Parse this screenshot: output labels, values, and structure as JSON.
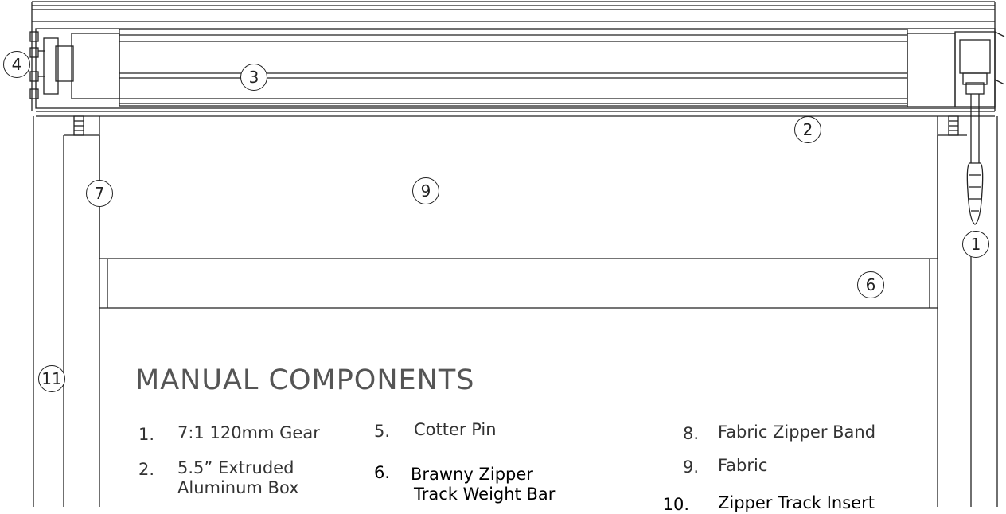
{
  "callouts": [
    "1",
    "2",
    "3",
    "4",
    "6",
    "7",
    "9",
    "11"
  ],
  "components": {
    "heading": "MANUAL COMPONENTS",
    "items": [
      {
        "number": "1.",
        "label": "7:1 120mm Gear"
      },
      {
        "number": "2.",
        "label": "5.5” Extruded",
        "label_line2": "Aluminum Box"
      },
      {
        "number": "5.",
        "label": "Cotter Pin"
      },
      {
        "number": "6.",
        "label": "Brawny Zipper",
        "label_line2": "Track Weight Bar"
      },
      {
        "number": "8.",
        "label": "Fabric Zipper Band"
      },
      {
        "number": "9.",
        "label": "Fabric"
      },
      {
        "number": "10.",
        "label": "Zipper Track Insert"
      }
    ]
  },
  "colors": {
    "line": "#222222",
    "background": "#ffffff",
    "heading": "#555555"
  }
}
